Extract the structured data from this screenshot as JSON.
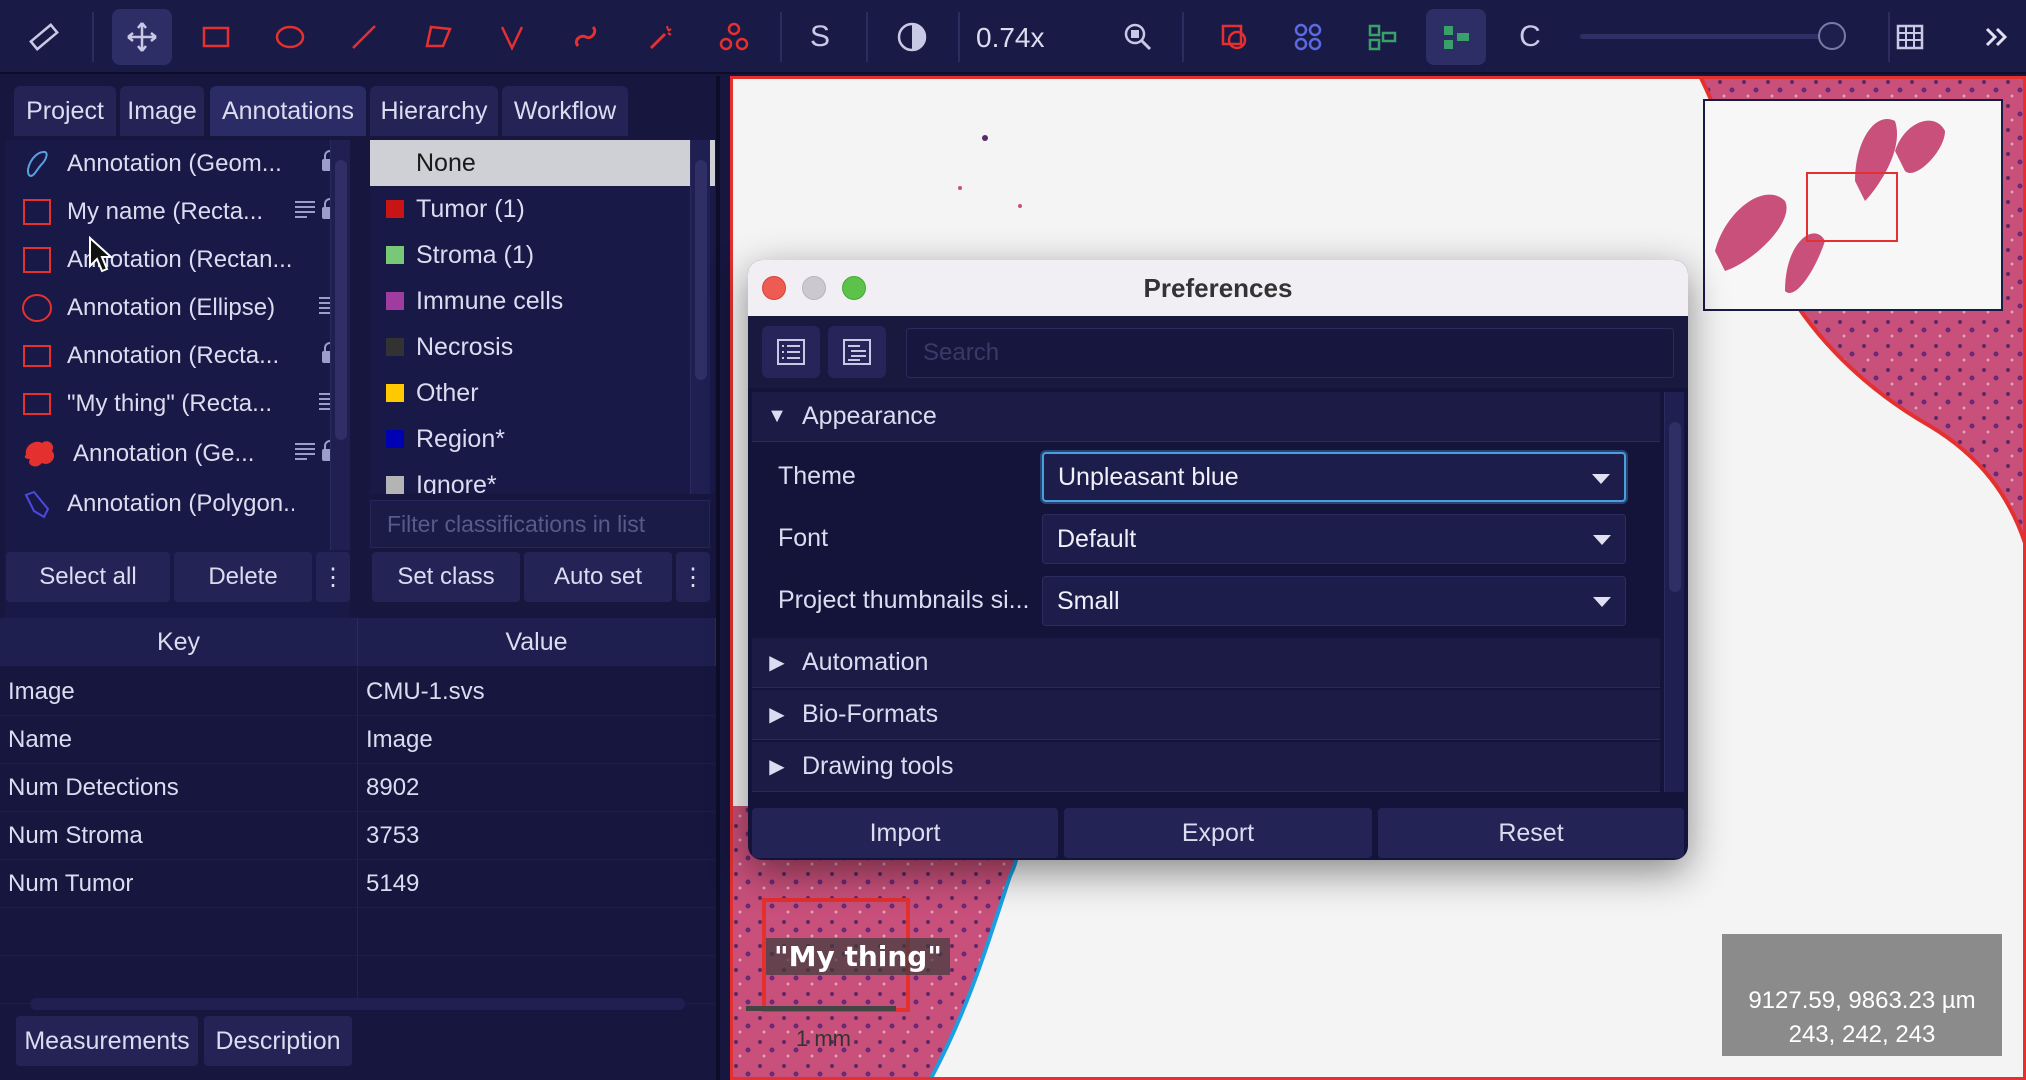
{
  "toolbar": {
    "zoom": "0.74x",
    "text_tool_s": "S",
    "text_tool_c": "C"
  },
  "left_panel": {
    "tabs": [
      "Project",
      "Image",
      "Annotations",
      "Hierarchy",
      "Workflow"
    ],
    "annotations": [
      {
        "label": "Annotation (Geom...",
        "icon": "geometry-icon",
        "locked": true,
        "has_description": false
      },
      {
        "label": "My name (Recta...",
        "icon": "rectangle-icon",
        "locked": true,
        "has_description": true
      },
      {
        "label": "Annotation (Rectan...",
        "icon": "rectangle-icon",
        "locked": false,
        "has_description": false
      },
      {
        "label": "Annotation (Ellipse)",
        "icon": "ellipse-icon",
        "locked": false,
        "has_description": true
      },
      {
        "label": "Annotation (Recta...",
        "icon": "rectangle-icon",
        "locked": true,
        "has_description": false
      },
      {
        "label": "\"My thing\" (Recta...",
        "icon": "rectangle-icon",
        "locked": false,
        "has_description": true
      },
      {
        "label": "Annotation (Ge...",
        "icon": "tissue-icon",
        "locked": true,
        "has_description": true
      },
      {
        "label": "Annotation (Polygon...",
        "icon": "polygon-icon",
        "locked": false,
        "has_description": false
      }
    ],
    "classes": [
      {
        "label": "None",
        "color": "",
        "selected": true
      },
      {
        "label": "Tumor (1)",
        "color": "#c81414"
      },
      {
        "label": "Stroma (1)",
        "color": "#78c878"
      },
      {
        "label": "Immune cells",
        "color": "#a03ca0"
      },
      {
        "label": "Necrosis",
        "color": "#323232"
      },
      {
        "label": "Other",
        "color": "#ffc800"
      },
      {
        "label": "Region*",
        "color": "#0000b4"
      },
      {
        "label": "Ignore*",
        "color": "#b4b4b4"
      }
    ],
    "class_filter_placeholder": "Filter classifications in list",
    "buttons": {
      "select_all": "Select all",
      "delete": "Delete",
      "set_class": "Set class",
      "auto_set": "Auto set",
      "more": "⋮"
    },
    "table": {
      "headers": [
        "Key",
        "Value"
      ],
      "rows": [
        [
          "Image",
          "CMU-1.svs"
        ],
        [
          "Name",
          "Image"
        ],
        [
          "Num Detections",
          "8902"
        ],
        [
          "Num Stroma",
          "3753"
        ],
        [
          "Num Tumor",
          "5149"
        ]
      ]
    },
    "bottom_tabs": [
      "Measurements",
      "Description"
    ]
  },
  "viewer": {
    "annotation_label": "\"My thing\"",
    "scale_bar": "1 mm",
    "coords_line1": "9127.59, 9863.23 µm",
    "coords_line2": "243, 242, 243"
  },
  "preferences": {
    "title": "Preferences",
    "search_placeholder": "Search",
    "sections": [
      {
        "label": "Appearance",
        "expanded": true
      },
      {
        "label": "Automation",
        "expanded": false
      },
      {
        "label": "Bio-Formats",
        "expanded": false
      },
      {
        "label": "Drawing tools",
        "expanded": false
      }
    ],
    "settings": [
      {
        "label": "Theme",
        "value": "Unpleasant blue"
      },
      {
        "label": "Font",
        "value": "Default"
      },
      {
        "label": "Project thumbnails si...",
        "value": "Small"
      }
    ],
    "buttons": [
      "Import",
      "Export",
      "Reset"
    ]
  },
  "colors": {
    "background": "#16163e",
    "toolbar": "#1a1a47",
    "accent_red": "#e53030",
    "focus_blue": "#4a9ede"
  }
}
